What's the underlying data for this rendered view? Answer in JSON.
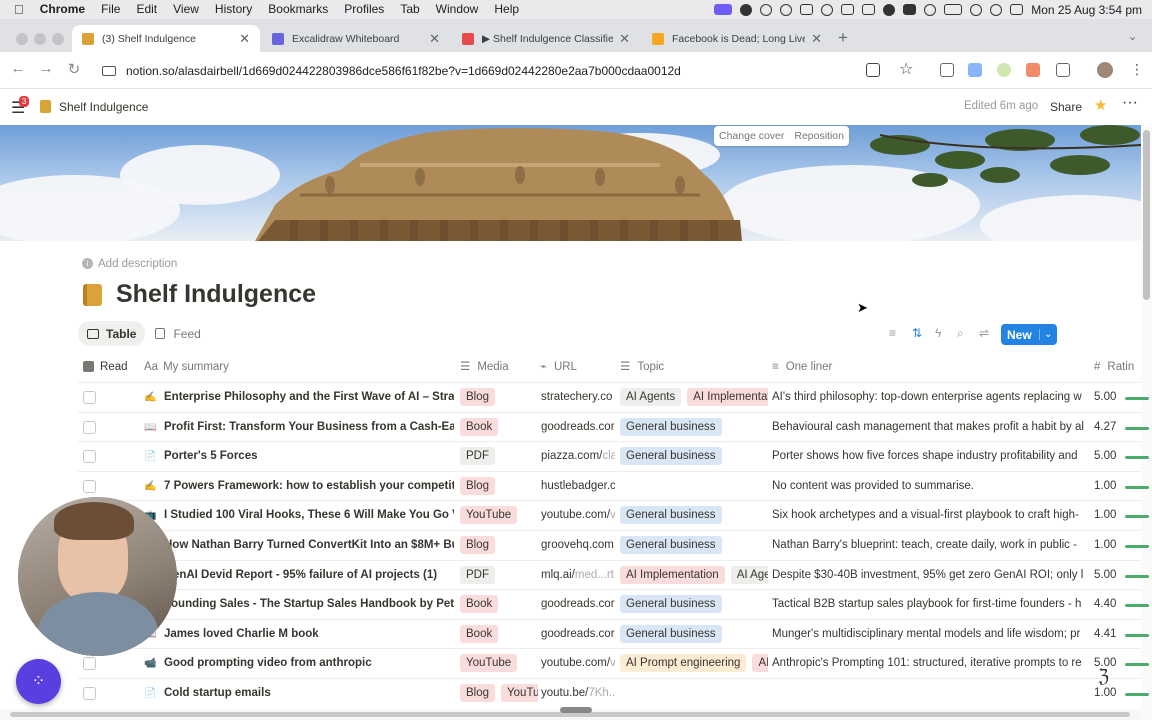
{
  "menubar": {
    "items": [
      "Chrome",
      "File",
      "Edit",
      "View",
      "History",
      "Bookmarks",
      "Profiles",
      "Tab",
      "Window",
      "Help"
    ],
    "clock": "Mon 25 Aug  3:54 pm"
  },
  "tabs": [
    {
      "title": "(3) Shelf Indulgence",
      "color": "#d9a33a",
      "active": true
    },
    {
      "title": "Excalidraw Whiteboard",
      "color": "#6965db",
      "active": false
    },
    {
      "title": "▶ Shelf Indulgence Classifie",
      "color": "#e64a4a",
      "active": false
    },
    {
      "title": "Facebook is Dead; Long Live",
      "color": "#f5a623",
      "active": false
    }
  ],
  "browser": {
    "url_host": "notion.so",
    "url_path": "/alasdairbell/1d669d024422803986dce586f61f82be?v=1d669d02442280e2aa7b000cdaa0012d"
  },
  "notion": {
    "notification_count": "3",
    "breadcrumb": "Shelf Indulgence",
    "edited": "Edited 6m ago",
    "share": "Share",
    "change_cover": "Change cover",
    "reposition": "Reposition",
    "add_description": "Add description",
    "page_title": "Shelf Indulgence",
    "views": [
      {
        "label": "Table",
        "active": true
      },
      {
        "label": "Feed",
        "active": false
      }
    ],
    "new_button": "New"
  },
  "table": {
    "headers": {
      "read": "Read",
      "summary": "My summary",
      "media": "Media",
      "url": "URL",
      "topic": "Topic",
      "oneliner": "One liner",
      "rating": "Ratin"
    },
    "rows": [
      {
        "icon": "✍️",
        "summary": "Enterprise Philosophy and the First Wave of AI – Stratec",
        "media": "Blog",
        "url": "stratechery.co",
        "url_muted": "",
        "topics": [
          "AI Agents",
          "AI Implementati"
        ],
        "oneliner": "AI's third philosophy: top-down enterprise agents replacing w",
        "rating": "5.00"
      },
      {
        "icon": "📖",
        "summary": "Profit First: Transform Your Business from a Cash-Eatin",
        "media": "Book",
        "url": "goodreads.cor",
        "url_muted": "",
        "topics": [
          "General business"
        ],
        "oneliner": "Behavioural cash management that makes profit a habit by al",
        "rating": "4.27"
      },
      {
        "icon": "📄",
        "summary": "Porter's 5 Forces",
        "media": "PDF",
        "url": "piazza.com/",
        "url_muted": "cla",
        "topics": [
          "General business"
        ],
        "oneliner": "Porter shows how five forces shape industry profitability and",
        "rating": "5.00"
      },
      {
        "icon": "✍️",
        "summary": "7 Powers Framework: how to establish your competitive",
        "media": "Blog",
        "url": "hustlebadger.c",
        "url_muted": "",
        "topics": [],
        "oneliner": "No content was provided to summarise.",
        "rating": "1.00"
      },
      {
        "icon": "📺",
        "summary": "I Studied 100 Viral Hooks, These 6 Will Make You Go Vi",
        "media": "YouTube",
        "url": "youtube.com/",
        "url_muted": "v",
        "topics": [
          "General business"
        ],
        "oneliner": "Six hook archetypes and a visual-first playbook to craft high-",
        "rating": "1.00"
      },
      {
        "icon": "✍️",
        "summary": "How Nathan Barry Turned ConvertKit Into an $8M+ Bus",
        "media": "Blog",
        "url": "groovehq.com",
        "url_muted": "",
        "topics": [
          "General business"
        ],
        "oneliner": "Nathan Barry's blueprint: teach, create daily, work in public -",
        "rating": "1.00"
      },
      {
        "icon": "📄",
        "summary": "GenAI Devid Report - 95% failure of AI projects (1)",
        "media": "PDF",
        "url": "mlq.ai/",
        "url_muted": "med...rt",
        "topics": [
          "AI Implementation",
          "AI Age"
        ],
        "oneliner": "Despite $30-40B investment, 95% get zero GenAI ROI; only l",
        "rating": "5.00"
      },
      {
        "icon": "📖",
        "summary": "Founding Sales - The Startup Sales Handbook by Peter",
        "media": "Book",
        "url": "goodreads.cor",
        "url_muted": "",
        "topics": [
          "General business"
        ],
        "oneliner": "Tactical B2B startup sales playbook for first-time founders - h",
        "rating": "4.40"
      },
      {
        "icon": "📖",
        "summary": "James loved Charlie M book",
        "media": "Book",
        "url": "goodreads.cor",
        "url_muted": "",
        "topics": [
          "General business"
        ],
        "oneliner": "Munger's multidisciplinary mental models and life wisdom; pr",
        "rating": "4.41"
      },
      {
        "icon": "📹",
        "summary": "Good prompting video from anthropic",
        "media": "YouTube",
        "url": "youtube.com/",
        "url_muted": "v",
        "topics": [
          "AI Prompt engineering",
          "AI"
        ],
        "oneliner": "Anthropic's Prompting 101: structured, iterative prompts to re",
        "rating": "5.00"
      },
      {
        "icon": "📄",
        "summary": "Cold startup emails",
        "media": "Blog",
        "media2": "YouTu",
        "url": "youtu.be/",
        "url_muted": "7Kh...",
        "topics": [],
        "oneliner": "",
        "rating": "1.00"
      }
    ]
  },
  "colors": {
    "blog": "#fadcdc",
    "book": "#fadcdc",
    "pdf": "#eeeeec",
    "youtube": "#fadcdc",
    "general_business": "#d9e6f5",
    "ai_agents": "#eeeeec",
    "ai_impl": "#fadcdc",
    "ai_prompt": "#fbecd3",
    "new_button": "#2383e2"
  }
}
